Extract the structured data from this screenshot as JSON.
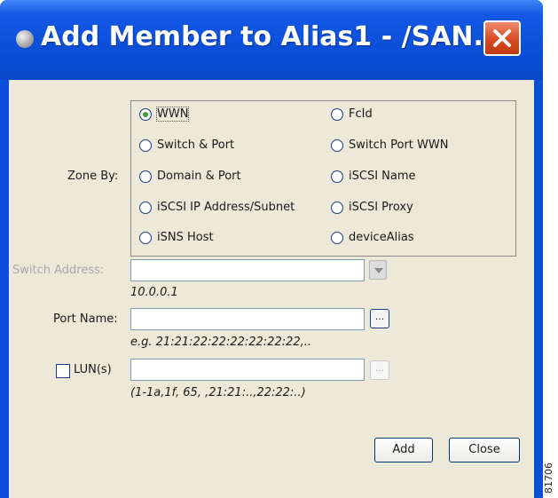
{
  "window": {
    "title": "Add Member to Alias1 - /SAN..."
  },
  "zone_by": {
    "label": "Zone By:",
    "options": [
      {
        "label": "WWN",
        "selected": true
      },
      {
        "label": "FcId",
        "selected": false
      },
      {
        "label": "Switch & Port",
        "selected": false
      },
      {
        "label": "Switch Port WWN",
        "selected": false
      },
      {
        "label": "Domain & Port",
        "selected": false
      },
      {
        "label": "iSCSI Name",
        "selected": false
      },
      {
        "label": "iSCSI IP Address/Subnet",
        "selected": false
      },
      {
        "label": "iSCSI Proxy",
        "selected": false
      },
      {
        "label": "iSNS Host",
        "selected": false
      },
      {
        "label": "deviceAlias",
        "selected": false
      }
    ]
  },
  "switch_address": {
    "label": "Switch Address:",
    "value": "",
    "hint": "10.0.0.1",
    "enabled": false
  },
  "port_name": {
    "label": "Port Name:",
    "value": "",
    "button_label": "...",
    "hint": "e.g. 21:21:22:22:22:22:22:22,.."
  },
  "luns": {
    "label": "LUN(s)",
    "checked": false,
    "value": "",
    "button_label": "...",
    "hint": "(1-1a,1f, 65, ,21:21:..,22:22:..)"
  },
  "buttons": {
    "add": "Add",
    "close": "Close"
  },
  "figure_number": "81706",
  "colors": {
    "titlebar": "#0b4fd9",
    "client_background": "#ece9d8",
    "close_button": "#d64a22",
    "selected_radio": "#3aa33a"
  }
}
